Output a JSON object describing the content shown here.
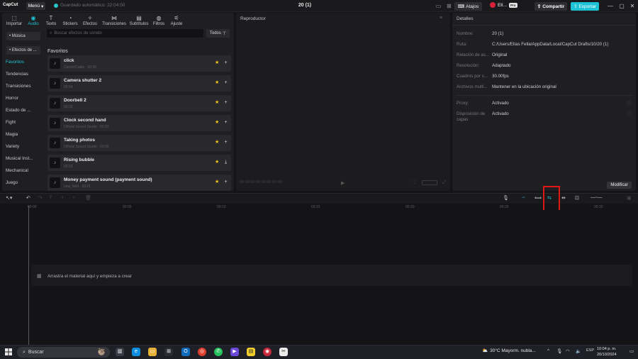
{
  "titlebar": {
    "logo": "CapCut",
    "menu": "Menú",
    "save_status": "Guardado automático: 22:04:50",
    "project_title": "20 (1)",
    "shortcuts": "Atajos",
    "user": "Elí...",
    "pro_badge": "Pro",
    "share": "Compartir",
    "export": "Exportar"
  },
  "tabs": [
    {
      "label": "Importar",
      "icon": "import-icon"
    },
    {
      "label": "Audio",
      "icon": "audio-icon",
      "active": true
    },
    {
      "label": "Texto",
      "icon": "text-icon"
    },
    {
      "label": "Stickers",
      "icon": "sticker-icon"
    },
    {
      "label": "Efectos",
      "icon": "effects-icon"
    },
    {
      "label": "Transiciones",
      "icon": "transitions-icon"
    },
    {
      "label": "Subtítulos",
      "icon": "subtitles-icon"
    },
    {
      "label": "Filtros",
      "icon": "filters-icon"
    },
    {
      "label": "Ajuste",
      "icon": "adjust-icon"
    }
  ],
  "categories": {
    "music": "• Música",
    "effects_section": "• Efectos de ...",
    "items": [
      "Favoritos",
      "Tendencias",
      "Transiciones",
      "Horror",
      "Estado de ...",
      "Fight",
      "Magia",
      "Variety",
      "Musical Inst...",
      "Mechanical",
      "Juego"
    ]
  },
  "search": {
    "placeholder": "Buscar efectos de sonido",
    "filter": "Todos"
  },
  "favorites_heading": "Favoritos",
  "sounds": [
    {
      "name": "click",
      "meta": "CarminCable · 00:00"
    },
    {
      "name": "Camera shutter 2",
      "meta": "00:04"
    },
    {
      "name": "Doorbell 2",
      "meta": "00:02"
    },
    {
      "name": "Clock second hand",
      "meta": "Official Sound Studio · 00:22"
    },
    {
      "name": "Taking photos",
      "meta": "Official Sound Studio · 00:00"
    },
    {
      "name": "Rising bubble",
      "meta": "00:03"
    },
    {
      "name": "Money payment sound (payment sound)",
      "meta": "new_field · 00:01"
    }
  ],
  "player": {
    "title": "Reproductor",
    "time": "00:00:00:00  00:00:00:00"
  },
  "details": {
    "title": "Detalles",
    "rows": [
      {
        "label": "Nombre:",
        "value": "20 (1)"
      },
      {
        "label": "Ruta:",
        "value": "C:/Users/Elías Fella/AppData/Local/CapCut Drafts/10/20 (1)"
      },
      {
        "label": "Relación de as...",
        "value": "Original"
      },
      {
        "label": "Resolución:",
        "value": "Adaptado"
      },
      {
        "label": "Cuadros por s...",
        "value": "30.00fps"
      },
      {
        "label": "Archivos multi...",
        "value": "Mantener en la ubicación original"
      }
    ],
    "proxy": {
      "label": "Proxy:",
      "value": "Activado"
    },
    "layers": {
      "label": "Disposición de capas",
      "value": "Activado"
    },
    "modify": "Modificar"
  },
  "timeline": {
    "ticks": [
      "00:00",
      "00:05",
      "00:10",
      "00:15",
      "00:20",
      "00:25",
      "00:30"
    ],
    "drop_text": "Arrastra el material aquí y empieza a crear"
  },
  "taskbar": {
    "search": "Buscar",
    "weather": "30°C  Mayorm. nubla...",
    "lang": "ESP",
    "time": "10:04 p. m.",
    "date": "20/10/2024"
  },
  "colors": {
    "accent": "#1ec2d5",
    "star": "#f4c21c",
    "highlight": "#e01717"
  }
}
